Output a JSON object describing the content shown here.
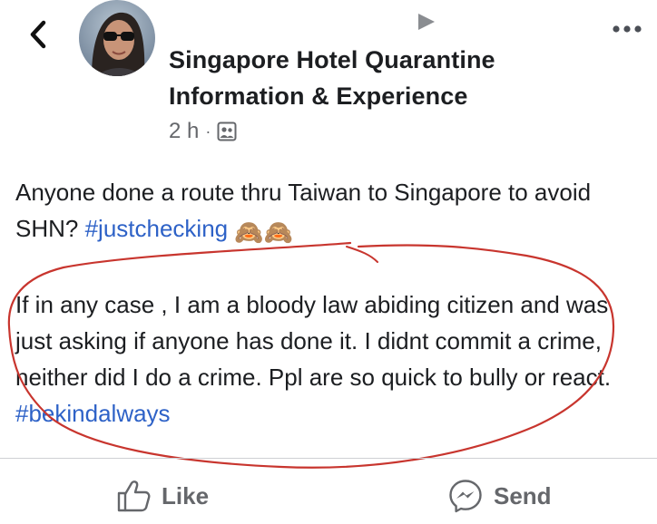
{
  "header": {
    "group_name_line1": "Singapore Hotel Quarantine",
    "group_name_line2": "Information & Experience",
    "time": "2 h",
    "separator": "·",
    "audience_icon": "group-audience-icon",
    "back_icon": "chevron-left-icon",
    "more_icon": "ellipsis-icon",
    "video_icon": "play-triangle-icon"
  },
  "post": {
    "p1_text": "Anyone done a route thru Taiwan to Singapore to avoid SHN? ",
    "p1_hashtag": "#justchecking",
    "p1_emoji": "🙈🙈",
    "p2_text": "If in any case , I am a bloody law abiding citizen and was just asking if anyone has done it. I didnt commit a crime, neither did I do a crime.  Ppl are so quick to bully or react. ",
    "p2_hashtag": "#bekindalways"
  },
  "actions": {
    "like_label": "Like",
    "send_label": "Send"
  },
  "colors": {
    "text": "#1c1e21",
    "secondary": "#65676b",
    "hashtag": "#2e62c7",
    "annotation": "#c8352e",
    "divider": "#ced0d4"
  }
}
